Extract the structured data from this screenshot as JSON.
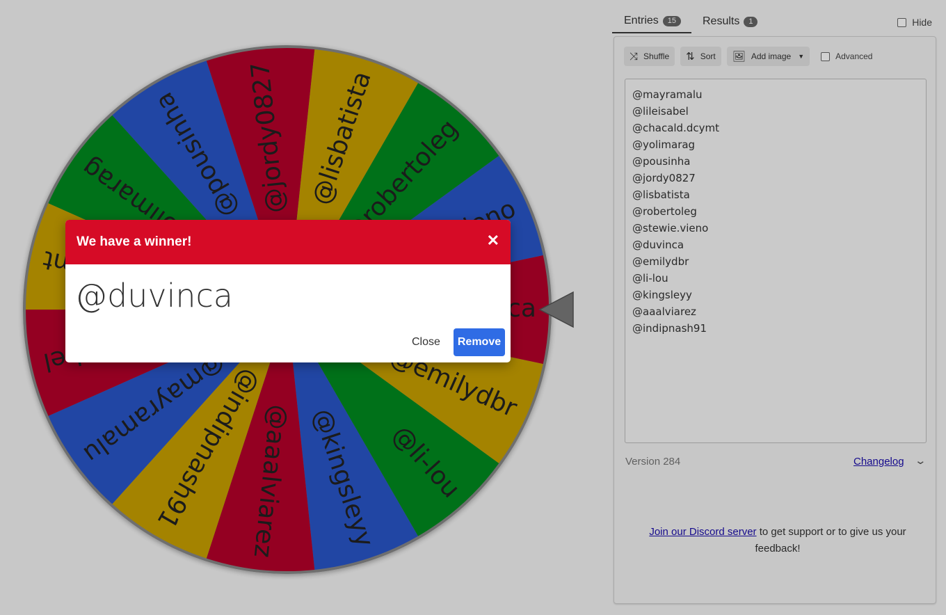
{
  "wheel": {
    "entries": [
      "@duvinca",
      "@emilydbr",
      "@li-lou",
      "@kingsleyy",
      "@aaalviarez",
      "@indipnash91",
      "@mayramalu",
      "@lileisabel",
      "@chacald.dcymt",
      "@yolimarag",
      "@pousinha",
      "@jordy0827",
      "@lisbatista",
      "@robertoleg",
      "@stewie.vieno"
    ],
    "colors": [
      "#b5002a",
      "#c8a000",
      "#008a1f",
      "#2956c9",
      "#b5002a",
      "#c8a000",
      "#2956c9",
      "#b5002a",
      "#c8a000",
      "#008a1f",
      "#2956c9",
      "#b5002a",
      "#c8a000",
      "#008a1f",
      "#2956c9"
    ]
  },
  "tabs": {
    "entries_label": "Entries",
    "entries_count": "15",
    "results_label": "Results",
    "results_count": "1",
    "hide_label": "Hide"
  },
  "toolbar": {
    "shuffle_label": "Shuffle",
    "sort_label": "Sort",
    "add_image_label": "Add image",
    "advanced_label": "Advanced"
  },
  "entries_list": [
    "@mayramalu",
    "@lileisabel",
    "@chacald.dcymt",
    "@yolimarag",
    "@pousinha",
    "@jordy0827",
    "@lisbatista",
    "@robertoleg",
    "@stewie.vieno",
    "@duvinca",
    "@emilydbr",
    "@li-lou",
    "@kingsleyy",
    "@aaalviarez",
    "@indipnash91"
  ],
  "footer": {
    "version": "Version 284",
    "changelog": "Changelog",
    "discord_link": "Join our Discord server",
    "discord_text": " to get support or to give us your feedback!"
  },
  "modal": {
    "title": "We have a winner!",
    "winner": "@duvinca",
    "close_label": "Close",
    "remove_label": "Remove"
  }
}
